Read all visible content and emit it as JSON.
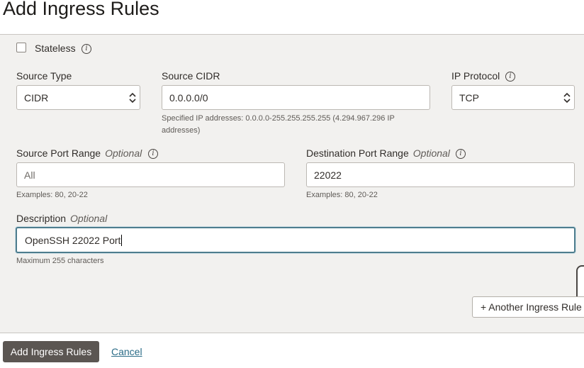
{
  "page": {
    "title": "Add Ingress Rules"
  },
  "form": {
    "stateless": {
      "label": "Stateless",
      "checked": false
    },
    "source_type": {
      "label": "Source Type",
      "value": "CIDR"
    },
    "source_cidr": {
      "label": "Source CIDR",
      "value": "0.0.0.0/0",
      "help": "Specified IP addresses: 0.0.0.0-255.255.255.255 (4.294.967.296 IP addresses)"
    },
    "ip_protocol": {
      "label": "IP Protocol",
      "value": "TCP"
    },
    "source_port_range": {
      "label": "Source Port Range",
      "optional": "Optional",
      "placeholder": "All",
      "help": "Examples: 80, 20-22"
    },
    "destination_port_range": {
      "label": "Destination Port Range",
      "optional": "Optional",
      "value": "22022",
      "help": "Examples: 80, 20-22"
    },
    "description": {
      "label": "Description",
      "optional": "Optional",
      "value": "OpenSSH 22022 Port",
      "help": "Maximum 255 characters"
    },
    "another_rule_button": "+ Another Ingress Rule"
  },
  "footer": {
    "submit_label": "Add Ingress Rules",
    "cancel_label": "Cancel"
  },
  "colors": {
    "primary_button": "#5b5652",
    "link": "#2b6c87",
    "focus_border": "#4e7d8e"
  }
}
